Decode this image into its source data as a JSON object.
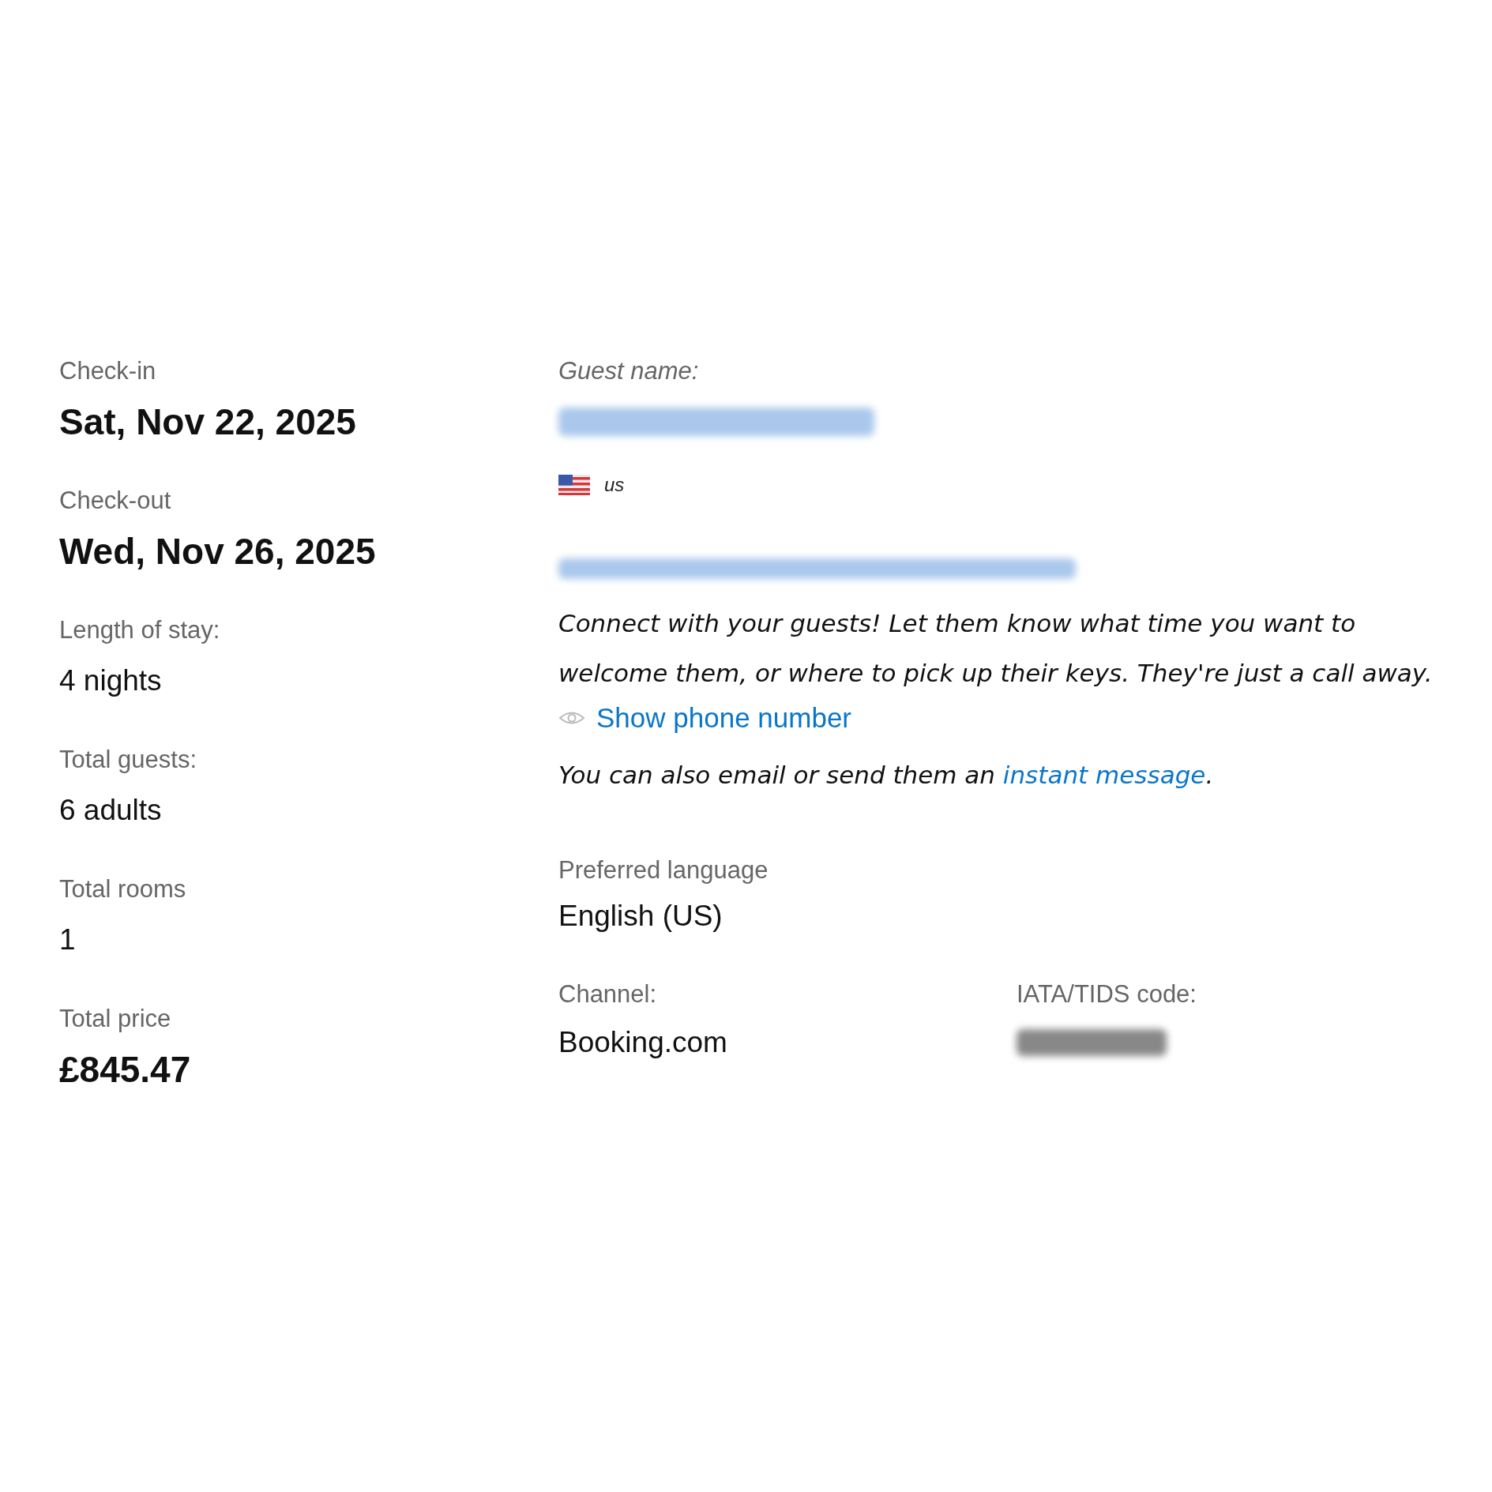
{
  "stay": [
    {
      "label": "Check-in",
      "value": "Sat, Nov 22, 2025",
      "kind": "major"
    },
    {
      "label": "Check-out",
      "value": "Wed, Nov 26, 2025",
      "kind": "major"
    },
    {
      "label": "Length of stay:",
      "value": "4 nights",
      "kind": "minor"
    },
    {
      "label": "Total guests:",
      "value": "6 adults",
      "kind": "minor"
    },
    {
      "label": "Total rooms",
      "value": "1",
      "kind": "minor"
    },
    {
      "label": "Total price",
      "value": "£845.47",
      "kind": "major"
    }
  ],
  "guest": {
    "label": "Guest name:",
    "country_code": "us",
    "message": "Connect with your guests! Let them know what time you want to welcome them, or where to pick up their keys. They're just a call away.",
    "show_phone": "Show phone number",
    "contact_before": "You can also email or send them an ",
    "contact_link": "instant message",
    "contact_after": "."
  },
  "details": [
    {
      "label": "Preferred language",
      "value": "English (US)"
    }
  ],
  "booking_info": [
    {
      "label": "Channel:",
      "value": "Booking.com",
      "redacted": false
    },
    {
      "label": "IATA/TIDS code:",
      "redacted": true
    }
  ]
}
